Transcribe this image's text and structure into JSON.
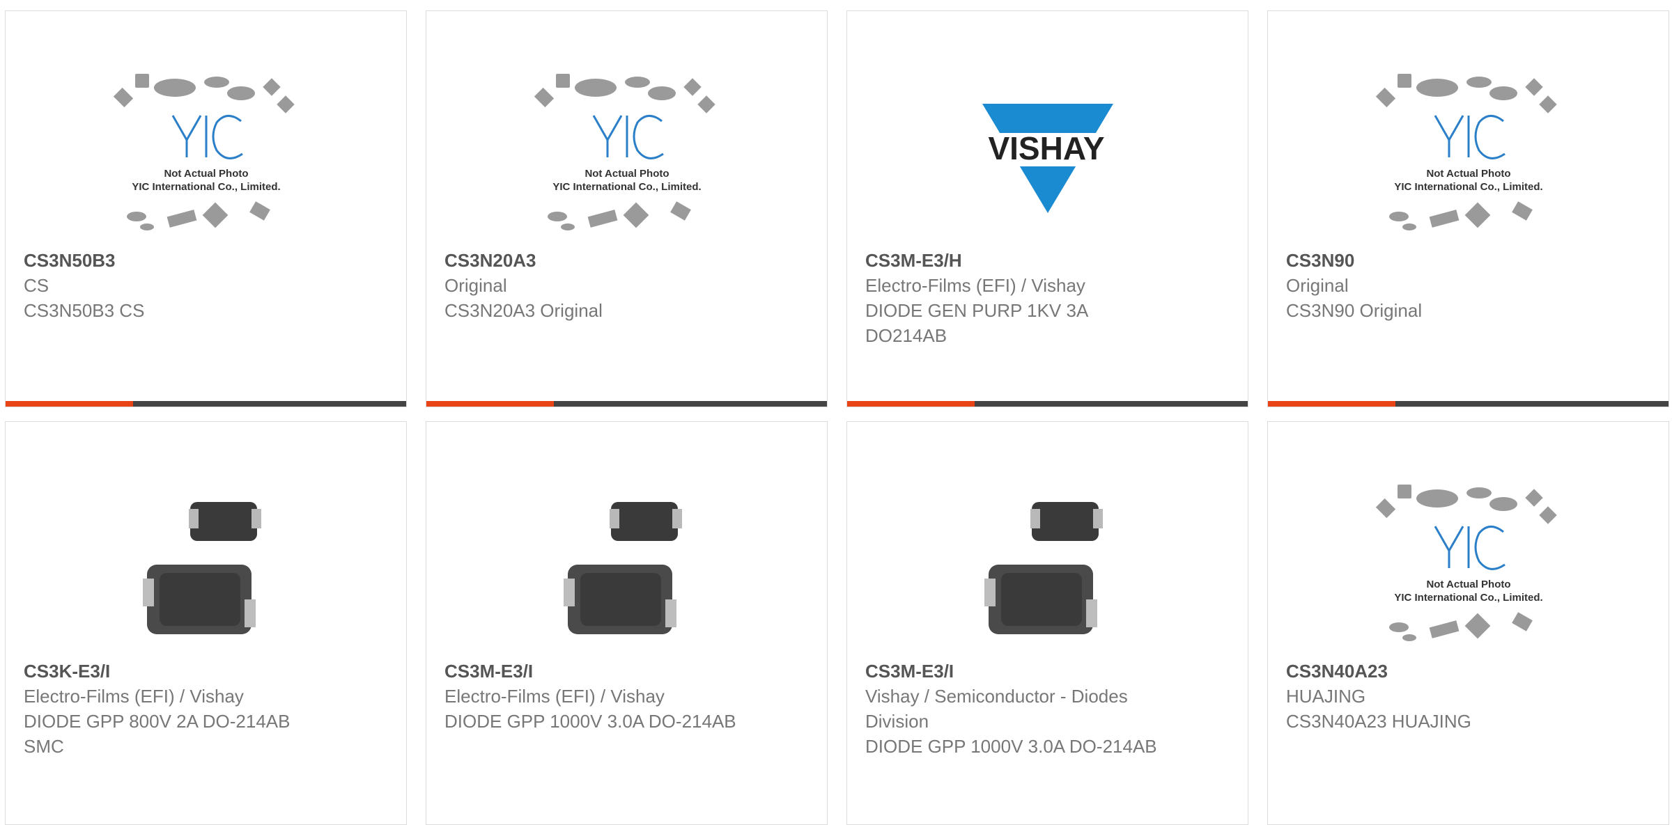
{
  "brand_colors": {
    "accent": "#e84418",
    "bar": "#444444",
    "vishay_blue": "#1a8ad1"
  },
  "yic_placeholder": {
    "line1": "Not Actual Photo",
    "line2": "YIC International Co., Limited."
  },
  "products": [
    {
      "part": "CS3N50B3",
      "mfr": "CS",
      "desc": "CS3N50B3 CS",
      "image": "yic-placeholder-icon"
    },
    {
      "part": "CS3N20A3",
      "mfr": "Original",
      "desc": "CS3N20A3 Original",
      "image": "yic-placeholder-icon"
    },
    {
      "part": "CS3M-E3/H",
      "mfr": "Electro-Films (EFI) / Vishay",
      "desc": "DIODE GEN PURP 1KV 3A DO214AB",
      "image": "vishay-logo",
      "logo_text": "VISHAY"
    },
    {
      "part": "CS3N90",
      "mfr": "Original",
      "desc": "CS3N90 Original",
      "image": "yic-placeholder-icon"
    },
    {
      "part": "CS3K-E3/I",
      "mfr": "Electro-Films (EFI) / Vishay",
      "desc": "DIODE GPP 800V 2A DO-214AB SMC",
      "image": "smd-diode-photo"
    },
    {
      "part": "CS3M-E3/I",
      "mfr": "Electro-Films (EFI) / Vishay",
      "desc": "DIODE GPP 1000V 3.0A DO-214AB",
      "image": "smd-diode-photo"
    },
    {
      "part": "CS3M-E3/I",
      "mfr": "Vishay / Semiconductor - Diodes Division",
      "desc": "DIODE GPP 1000V 3.0A DO-214AB",
      "image": "smd-diode-photo"
    },
    {
      "part": "CS3N40A23",
      "mfr": "HUAJING",
      "desc": "CS3N40A23 HUAJING",
      "image": "yic-placeholder-icon"
    }
  ]
}
